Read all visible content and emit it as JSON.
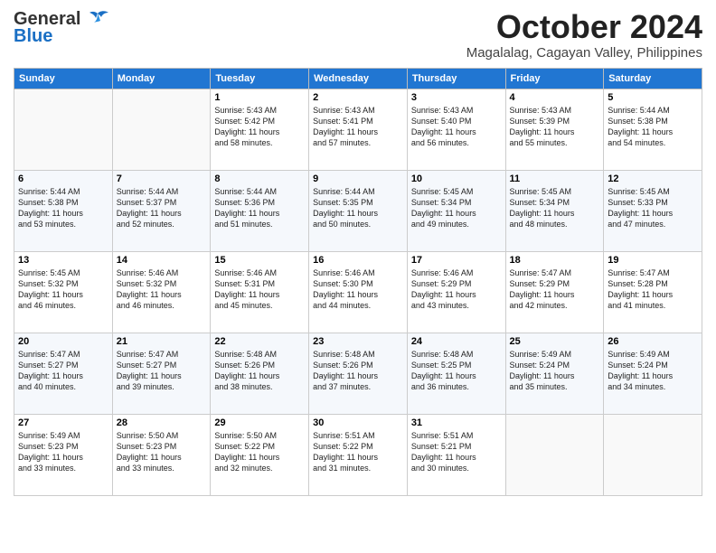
{
  "header": {
    "logo_line1": "General",
    "logo_line2": "Blue",
    "month": "October 2024",
    "location": "Magalalag, Cagayan Valley, Philippines"
  },
  "weekdays": [
    "Sunday",
    "Monday",
    "Tuesday",
    "Wednesday",
    "Thursday",
    "Friday",
    "Saturday"
  ],
  "weeks": [
    [
      {
        "day": "",
        "info": ""
      },
      {
        "day": "",
        "info": ""
      },
      {
        "day": "1",
        "info": "Sunrise: 5:43 AM\nSunset: 5:42 PM\nDaylight: 11 hours\nand 58 minutes."
      },
      {
        "day": "2",
        "info": "Sunrise: 5:43 AM\nSunset: 5:41 PM\nDaylight: 11 hours\nand 57 minutes."
      },
      {
        "day": "3",
        "info": "Sunrise: 5:43 AM\nSunset: 5:40 PM\nDaylight: 11 hours\nand 56 minutes."
      },
      {
        "day": "4",
        "info": "Sunrise: 5:43 AM\nSunset: 5:39 PM\nDaylight: 11 hours\nand 55 minutes."
      },
      {
        "day": "5",
        "info": "Sunrise: 5:44 AM\nSunset: 5:38 PM\nDaylight: 11 hours\nand 54 minutes."
      }
    ],
    [
      {
        "day": "6",
        "info": "Sunrise: 5:44 AM\nSunset: 5:38 PM\nDaylight: 11 hours\nand 53 minutes."
      },
      {
        "day": "7",
        "info": "Sunrise: 5:44 AM\nSunset: 5:37 PM\nDaylight: 11 hours\nand 52 minutes."
      },
      {
        "day": "8",
        "info": "Sunrise: 5:44 AM\nSunset: 5:36 PM\nDaylight: 11 hours\nand 51 minutes."
      },
      {
        "day": "9",
        "info": "Sunrise: 5:44 AM\nSunset: 5:35 PM\nDaylight: 11 hours\nand 50 minutes."
      },
      {
        "day": "10",
        "info": "Sunrise: 5:45 AM\nSunset: 5:34 PM\nDaylight: 11 hours\nand 49 minutes."
      },
      {
        "day": "11",
        "info": "Sunrise: 5:45 AM\nSunset: 5:34 PM\nDaylight: 11 hours\nand 48 minutes."
      },
      {
        "day": "12",
        "info": "Sunrise: 5:45 AM\nSunset: 5:33 PM\nDaylight: 11 hours\nand 47 minutes."
      }
    ],
    [
      {
        "day": "13",
        "info": "Sunrise: 5:45 AM\nSunset: 5:32 PM\nDaylight: 11 hours\nand 46 minutes."
      },
      {
        "day": "14",
        "info": "Sunrise: 5:46 AM\nSunset: 5:32 PM\nDaylight: 11 hours\nand 46 minutes."
      },
      {
        "day": "15",
        "info": "Sunrise: 5:46 AM\nSunset: 5:31 PM\nDaylight: 11 hours\nand 45 minutes."
      },
      {
        "day": "16",
        "info": "Sunrise: 5:46 AM\nSunset: 5:30 PM\nDaylight: 11 hours\nand 44 minutes."
      },
      {
        "day": "17",
        "info": "Sunrise: 5:46 AM\nSunset: 5:29 PM\nDaylight: 11 hours\nand 43 minutes."
      },
      {
        "day": "18",
        "info": "Sunrise: 5:47 AM\nSunset: 5:29 PM\nDaylight: 11 hours\nand 42 minutes."
      },
      {
        "day": "19",
        "info": "Sunrise: 5:47 AM\nSunset: 5:28 PM\nDaylight: 11 hours\nand 41 minutes."
      }
    ],
    [
      {
        "day": "20",
        "info": "Sunrise: 5:47 AM\nSunset: 5:27 PM\nDaylight: 11 hours\nand 40 minutes."
      },
      {
        "day": "21",
        "info": "Sunrise: 5:47 AM\nSunset: 5:27 PM\nDaylight: 11 hours\nand 39 minutes."
      },
      {
        "day": "22",
        "info": "Sunrise: 5:48 AM\nSunset: 5:26 PM\nDaylight: 11 hours\nand 38 minutes."
      },
      {
        "day": "23",
        "info": "Sunrise: 5:48 AM\nSunset: 5:26 PM\nDaylight: 11 hours\nand 37 minutes."
      },
      {
        "day": "24",
        "info": "Sunrise: 5:48 AM\nSunset: 5:25 PM\nDaylight: 11 hours\nand 36 minutes."
      },
      {
        "day": "25",
        "info": "Sunrise: 5:49 AM\nSunset: 5:24 PM\nDaylight: 11 hours\nand 35 minutes."
      },
      {
        "day": "26",
        "info": "Sunrise: 5:49 AM\nSunset: 5:24 PM\nDaylight: 11 hours\nand 34 minutes."
      }
    ],
    [
      {
        "day": "27",
        "info": "Sunrise: 5:49 AM\nSunset: 5:23 PM\nDaylight: 11 hours\nand 33 minutes."
      },
      {
        "day": "28",
        "info": "Sunrise: 5:50 AM\nSunset: 5:23 PM\nDaylight: 11 hours\nand 33 minutes."
      },
      {
        "day": "29",
        "info": "Sunrise: 5:50 AM\nSunset: 5:22 PM\nDaylight: 11 hours\nand 32 minutes."
      },
      {
        "day": "30",
        "info": "Sunrise: 5:51 AM\nSunset: 5:22 PM\nDaylight: 11 hours\nand 31 minutes."
      },
      {
        "day": "31",
        "info": "Sunrise: 5:51 AM\nSunset: 5:21 PM\nDaylight: 11 hours\nand 30 minutes."
      },
      {
        "day": "",
        "info": ""
      },
      {
        "day": "",
        "info": ""
      }
    ]
  ]
}
